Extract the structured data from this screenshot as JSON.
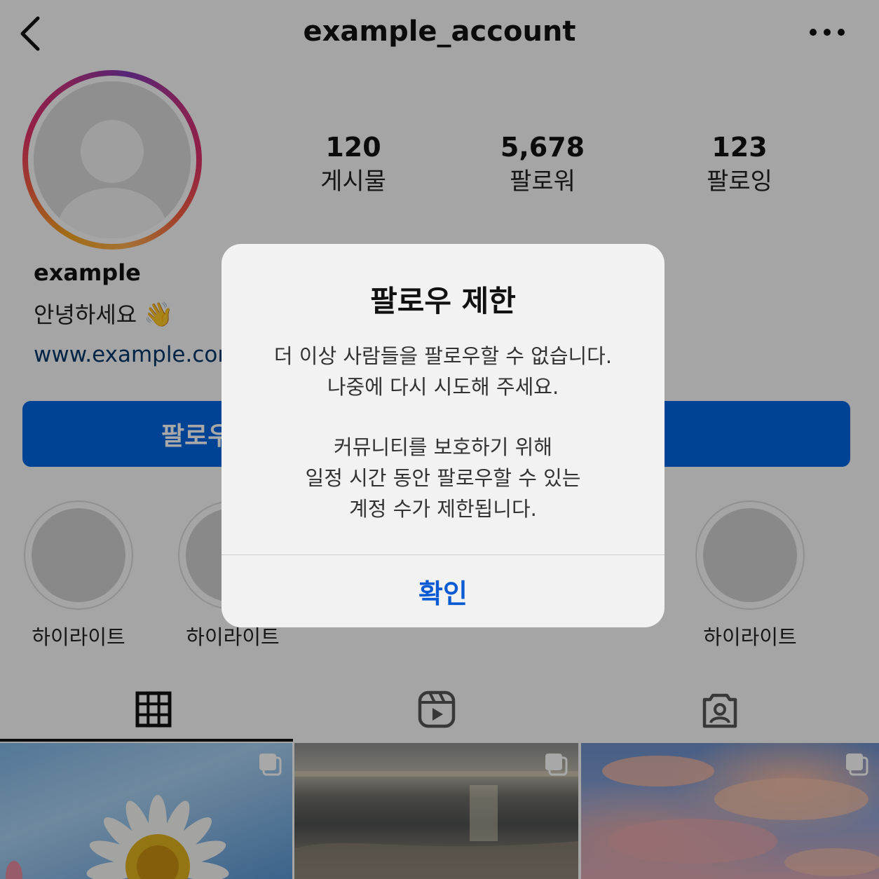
{
  "header": {
    "title": "example_account",
    "back_icon": "chevron-left-icon",
    "more_icon": "ellipsis-icon"
  },
  "profile": {
    "avatar_icon": "default-avatar-icon",
    "stats": [
      {
        "value": "120",
        "label": "게시물"
      },
      {
        "value": "5,678",
        "label": "팔로워"
      },
      {
        "value": "123",
        "label": "팔로잉"
      }
    ],
    "display_name": "example",
    "bio": "안녕하세요",
    "bio_emoji": "👋",
    "link": "www.example.com",
    "follow_label": "팔로우"
  },
  "highlights": [
    {
      "label": "하이라이트"
    },
    {
      "label": "하이라이트"
    },
    {
      "label": "하이라이트"
    }
  ],
  "tabs": [
    {
      "icon": "grid-icon",
      "selected": true
    },
    {
      "icon": "reels-icon",
      "selected": false
    },
    {
      "icon": "tagged-icon",
      "selected": false
    }
  ],
  "posts": [
    {
      "icon": "multiple-photos-icon"
    },
    {
      "icon": "multiple-photos-icon"
    },
    {
      "icon": "multiple-photos-icon"
    }
  ],
  "dialog": {
    "title": "팔로우 제한",
    "message_line1": "더 이상 사람들을 팔로우할 수 없습니다.",
    "message_line2": "나중에 다시 시도해 주세요.",
    "message_line3": "커뮤니티를 보호하기 위해",
    "message_line4": "일정 시간 동안 팔로우할 수 있는",
    "message_line5": "계정 수가 제한됩니다.",
    "confirm_label": "확인"
  },
  "colors": {
    "follow_button": "#0064e0",
    "link": "#00376b",
    "dialog_button": "#0a5bd3"
  }
}
